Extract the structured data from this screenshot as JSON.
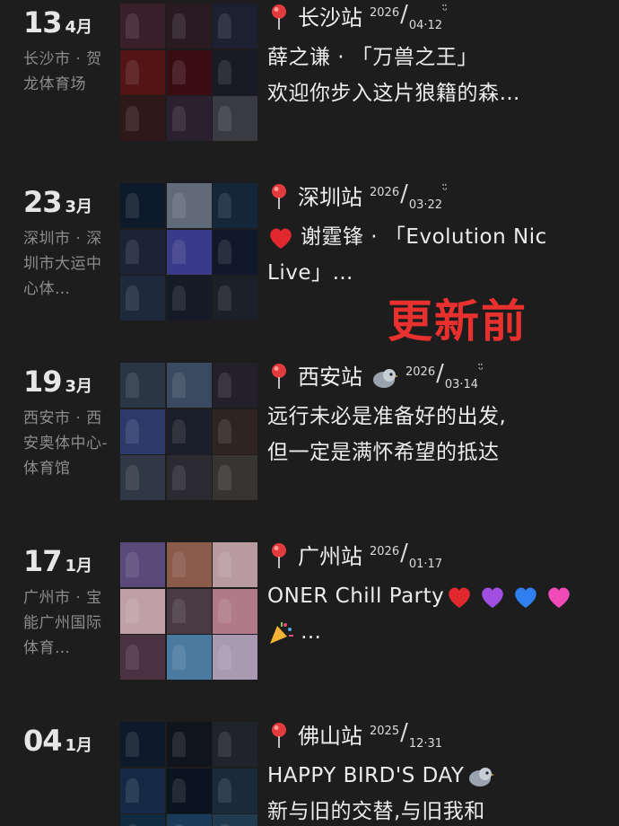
{
  "overlay_text": "更新前",
  "colors": {
    "background": "#1d1d1d",
    "location": "#8c8c8c",
    "accent": "#e8312e"
  },
  "entries": [
    {
      "day": "13",
      "month": "4月",
      "location": "长沙市 · 贺龙体育场",
      "station": "长沙站",
      "year": "2026",
      "md": "04·12",
      "smile": "ᵕ̈",
      "lines": [
        "薛之谦 · 「万兽之王」",
        "欢迎你步入这片狼籍的森…"
      ],
      "tiles": [
        "#3a1f2a",
        "#2a1a22",
        "#1c2030",
        "#521414",
        "#3a0d12",
        "#1a1a24",
        "#2e1818",
        "#2a2030",
        "#3a3a42"
      ]
    },
    {
      "day": "23",
      "month": "3月",
      "location": "深圳市 · 深圳市大运中心体…",
      "station": "深圳站",
      "year": "2026",
      "md": "03·22",
      "smile": "ᵕ̈",
      "lines": [
        "谢霆锋 · 「Evolution Nic",
        "Live」…"
      ],
      "heart_line": 0,
      "tiles": [
        "#0d1a2a",
        "#606a78",
        "#14263a",
        "#1a2436",
        "#3a3a8a",
        "#10182a",
        "#1e2a3c",
        "#141a26",
        "#1c2028"
      ]
    },
    {
      "day": "19",
      "month": "3月",
      "location": "西安市 · 西安奥体中心-体育馆",
      "station": "西安站",
      "year": "2026",
      "md": "03·14",
      "smile": "ᵕ̈",
      "bird": true,
      "lines": [
        "远行未必是准备好的出发,",
        "但一定是满怀希望的抵达"
      ],
      "tiles": [
        "#2a3644",
        "#3a4a60",
        "#24202a",
        "#2c3a6a",
        "#1a1e2a",
        "#302420",
        "#303846",
        "#2a2a30",
        "#383432"
      ]
    },
    {
      "day": "17",
      "month": "1月",
      "location": "广州市 · 宝能广州国际体育…",
      "station": "广州站",
      "year": "2026",
      "md": "01·17",
      "smile": "",
      "lines": [
        "ONER Chill Party",
        "…"
      ],
      "emoji_line": 0,
      "party_line": 1,
      "tiles": [
        "#5a4a7a",
        "#8a5a4a",
        "#b89aa0",
        "#c0a0a8",
        "#4a3a44",
        "#b07a8a",
        "#4a3240",
        "#4a7aa0",
        "#a89ab0"
      ]
    },
    {
      "day": "04",
      "month": "1月",
      "location": "",
      "station": "佛山站",
      "year": "2025",
      "md": "12·31",
      "smile": "",
      "lines": [
        "HAPPY BIRD'S DAY",
        "新与旧的交替,与旧我和"
      ],
      "bird_line": 0,
      "tiles": [
        "#0e1a2a",
        "#10141c",
        "#20242a",
        "#142a44",
        "#0a1420",
        "#1a2a3a",
        "#102a40",
        "#1a3a5a",
        "#203a50"
      ]
    }
  ]
}
